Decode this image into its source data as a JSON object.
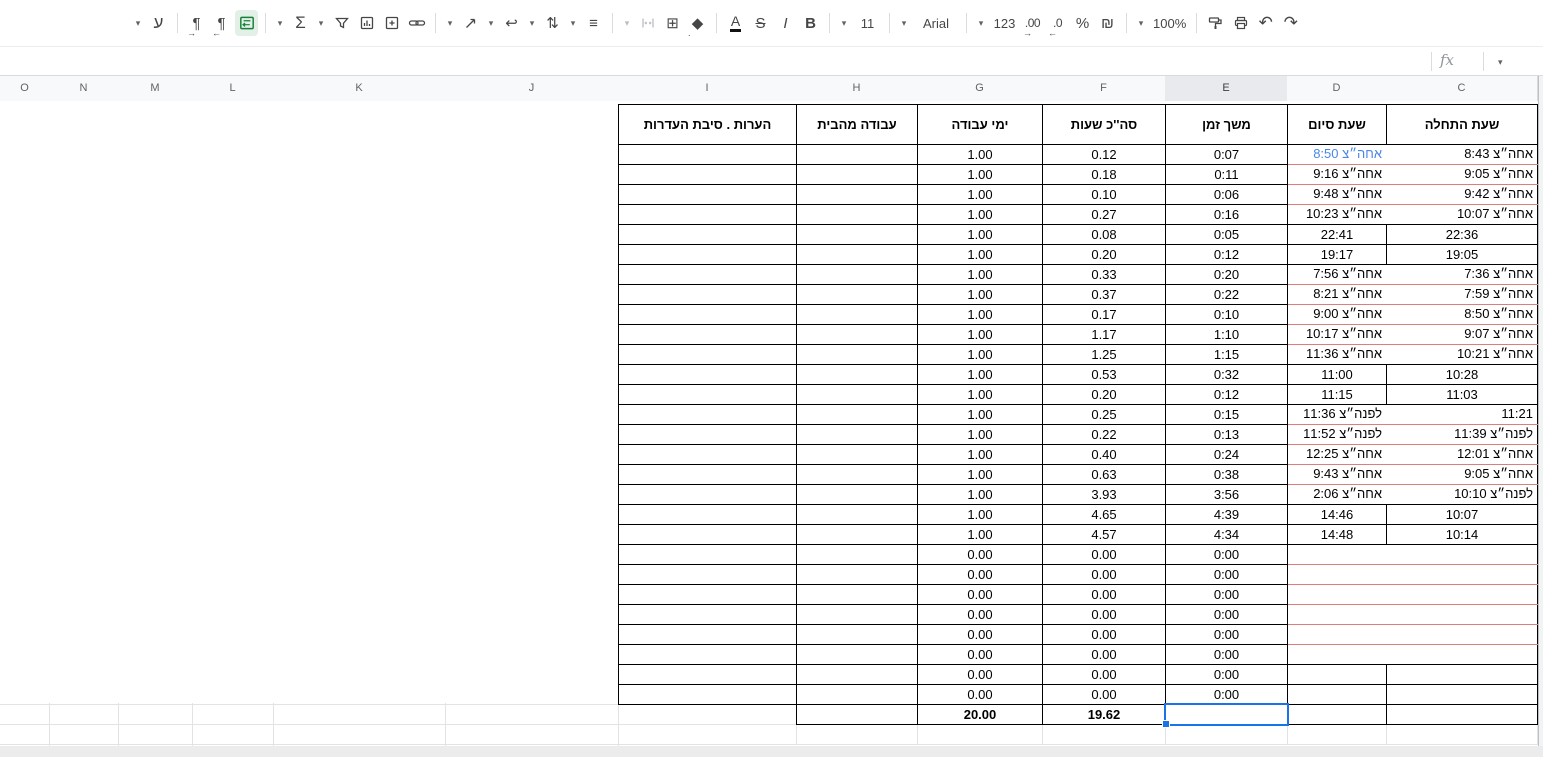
{
  "toolbar": {
    "items": [
      {
        "name": "toolbar-overflow-dropdown",
        "type": "icon",
        "glyph": "▾",
        "small": true
      },
      {
        "name": "input-tools-button",
        "type": "icon",
        "glyph": "ע",
        "cls": "biglyph"
      },
      {
        "type": "sep"
      },
      {
        "name": "text-direction-ltr-button",
        "type": "icon",
        "glyph": "¶",
        "sub": "→"
      },
      {
        "name": "text-direction-rtl-button",
        "type": "icon",
        "glyph": "¶",
        "sub": "←"
      },
      {
        "name": "sheet-direction-rtl-button",
        "type": "svg",
        "svg": "sheetdir",
        "active": true
      },
      {
        "type": "sep"
      },
      {
        "name": "functions-dropdown",
        "type": "icon",
        "glyph": "▾",
        "small": true
      },
      {
        "name": "functions-button",
        "type": "icon",
        "glyph": "Σ",
        "cls": "biglyph"
      },
      {
        "name": "filter-views-dropdown",
        "type": "icon",
        "glyph": "▾",
        "small": true
      },
      {
        "name": "create-filter-button",
        "type": "svg",
        "svg": "funnel"
      },
      {
        "name": "insert-chart-button",
        "type": "svg",
        "svg": "chart"
      },
      {
        "name": "insert-comment-button",
        "type": "svg",
        "svg": "note"
      },
      {
        "name": "insert-link-button",
        "type": "svg",
        "svg": "link"
      },
      {
        "type": "sep"
      },
      {
        "name": "text-rotation-dropdown",
        "type": "icon",
        "glyph": "▾",
        "small": true
      },
      {
        "name": "text-rotation-button",
        "type": "svg",
        "svg": "rotation"
      },
      {
        "name": "text-wrapping-dropdown",
        "type": "icon",
        "glyph": "▾",
        "small": true
      },
      {
        "name": "text-wrapping-button",
        "type": "icon",
        "glyph": "↩"
      },
      {
        "name": "vertical-align-dropdown",
        "type": "icon",
        "glyph": "▾",
        "small": true
      },
      {
        "name": "vertical-align-button",
        "type": "icon",
        "glyph": "⇅"
      },
      {
        "name": "horizontal-align-dropdown",
        "type": "icon",
        "glyph": "▾",
        "small": true
      },
      {
        "name": "horizontal-align-button",
        "type": "icon",
        "glyph": "≡"
      },
      {
        "type": "sep"
      },
      {
        "name": "merge-type-dropdown",
        "type": "icon",
        "glyph": "▾",
        "small": true,
        "disabled": true
      },
      {
        "name": "merge-cells-button",
        "type": "svg",
        "svg": "merge",
        "disabled": true
      },
      {
        "name": "borders-button",
        "type": "icon",
        "glyph": "⊞"
      },
      {
        "name": "fill-color-button",
        "type": "icon",
        "glyph": "◆",
        "sub": "."
      },
      {
        "type": "sep"
      },
      {
        "name": "text-color-button",
        "type": "icon",
        "glyph": "A",
        "cls": "textcolor"
      },
      {
        "name": "strikethrough-button",
        "type": "icon",
        "glyph": "S",
        "cls": "strike"
      },
      {
        "name": "italic-button",
        "type": "icon",
        "glyph": "I",
        "cls": "ital"
      },
      {
        "name": "bold-button",
        "type": "icon",
        "glyph": "B",
        "cls": "boldb"
      },
      {
        "type": "sep"
      },
      {
        "name": "font-size-dropdown",
        "type": "icon",
        "glyph": "▾",
        "small": true
      },
      {
        "name": "font-size-value",
        "type": "text",
        "glyph": "11"
      },
      {
        "type": "sep"
      },
      {
        "name": "font-family-dropdown",
        "type": "icon",
        "glyph": "▾",
        "small": true
      },
      {
        "name": "font-family-value",
        "type": "text",
        "glyph": "Arial",
        "wide": true
      },
      {
        "type": "sep"
      },
      {
        "name": "number-format-dropdown",
        "type": "icon",
        "glyph": "▾",
        "small": true
      },
      {
        "name": "number-format-button",
        "type": "text",
        "glyph": "123"
      },
      {
        "name": "increase-decimals-button",
        "type": "icon",
        "glyph": ".00",
        "sub": "→",
        "cls": "dec"
      },
      {
        "name": "decrease-decimals-button",
        "type": "icon",
        "glyph": ".0",
        "sub": "←",
        "cls": "dec"
      },
      {
        "name": "percent-format-button",
        "type": "icon",
        "glyph": "%"
      },
      {
        "name": "currency-format-button",
        "type": "icon",
        "glyph": "₪"
      },
      {
        "type": "sep"
      },
      {
        "name": "zoom-dropdown",
        "type": "icon",
        "glyph": "▾",
        "small": true
      },
      {
        "name": "zoom-value",
        "type": "text",
        "glyph": "100%"
      },
      {
        "type": "sep"
      },
      {
        "name": "paint-format-button",
        "type": "svg",
        "svg": "roller"
      },
      {
        "name": "print-button",
        "type": "svg",
        "svg": "printer"
      },
      {
        "name": "undo-button",
        "type": "icon",
        "glyph": "↶",
        "cls": "biglyph"
      },
      {
        "name": "redo-button",
        "type": "icon",
        "glyph": "↷",
        "cls": "biglyph"
      }
    ]
  },
  "formula_bar": {
    "fx_label": "fx",
    "dropdown_glyph": "▾"
  },
  "grid": {
    "col_letters": [
      "O",
      "N",
      "M",
      "L",
      "K",
      "J",
      "I",
      "H",
      "G",
      "F",
      "E",
      "D",
      "C"
    ],
    "selected_column": "E",
    "headers": {
      "i": "הערות . סיבת העדרות",
      "h": "עבודה מהבית",
      "g": "ימי עבודה",
      "f": "סה''כ שעות",
      "e": "משך זמן",
      "d": "שעת סיום",
      "c": "שעת התחלה"
    },
    "rows": [
      {
        "c": "אחה״צ 8:43",
        "d": "אחה״צ 8:50",
        "e": "0:07",
        "f": "0.12",
        "g": "1.00",
        "style": "pink",
        "d_blue": true
      },
      {
        "c": "אחה״צ 9:05",
        "d": "אחה״צ 9:16",
        "e": "0:11",
        "f": "0.18",
        "g": "1.00",
        "style": "pink"
      },
      {
        "c": "אחה״צ 9:42",
        "d": "אחה״צ 9:48",
        "e": "0:06",
        "f": "0.10",
        "g": "1.00",
        "style": "pink"
      },
      {
        "c": "אחה״צ 10:07",
        "d": "אחה״צ 10:23",
        "e": "0:16",
        "f": "0.27",
        "g": "1.00",
        "style": "pink"
      },
      {
        "c": "22:36",
        "d": "22:41",
        "e": "0:05",
        "f": "0.08",
        "g": "1.00",
        "style": "black"
      },
      {
        "c": "19:05",
        "d": "19:17",
        "e": "0:12",
        "f": "0.20",
        "g": "1.00",
        "style": "black"
      },
      {
        "c": "אחה״צ 7:36",
        "d": "אחה״צ 7:56",
        "e": "0:20",
        "f": "0.33",
        "g": "1.00",
        "style": "pink"
      },
      {
        "c": "אחה״צ 7:59",
        "d": "אחה״צ 8:21",
        "e": "0:22",
        "f": "0.37",
        "g": "1.00",
        "style": "pink"
      },
      {
        "c": "אחה״צ 8:50",
        "d": "אחה״צ 9:00",
        "e": "0:10",
        "f": "0.17",
        "g": "1.00",
        "style": "pink"
      },
      {
        "c": "אחה״צ 9:07",
        "d": "אחה״צ 10:17",
        "e": "1:10",
        "f": "1.17",
        "g": "1.00",
        "style": "pink"
      },
      {
        "c": "אחה״צ 10:21",
        "d": "אחה״צ 11:36",
        "e": "1:15",
        "f": "1.25",
        "g": "1.00",
        "style": "pink"
      },
      {
        "c": "10:28",
        "d": "11:00",
        "e": "0:32",
        "f": "0.53",
        "g": "1.00",
        "style": "black"
      },
      {
        "c": "11:03",
        "d": "11:15",
        "e": "0:12",
        "f": "0.20",
        "g": "1.00",
        "style": "black"
      },
      {
        "c": "11:21",
        "d": "לפנה״צ 11:36",
        "e": "0:15",
        "f": "0.25",
        "g": "1.00",
        "style": "pink"
      },
      {
        "c": "לפנה״צ 11:39",
        "d": "לפנה״צ 11:52",
        "e": "0:13",
        "f": "0.22",
        "g": "1.00",
        "style": "pink"
      },
      {
        "c": "אחה״צ 12:01",
        "d": "אחה״צ 12:25",
        "e": "0:24",
        "f": "0.40",
        "g": "1.00",
        "style": "pink"
      },
      {
        "c": "אחה״צ 9:05",
        "d": "אחה״צ 9:43",
        "e": "0:38",
        "f": "0.63",
        "g": "1.00",
        "style": "pink"
      },
      {
        "c": "לפנה״צ 10:10",
        "d": "אחה״צ 2:06",
        "e": "3:56",
        "f": "3.93",
        "g": "1.00",
        "style": "pink"
      },
      {
        "c": "10:07",
        "d": "14:46",
        "e": "4:39",
        "f": "4.65",
        "g": "1.00",
        "style": "black"
      },
      {
        "c": "10:14",
        "d": "14:48",
        "e": "4:34",
        "f": "4.57",
        "g": "1.00",
        "style": "black"
      },
      {
        "c": "",
        "d": "",
        "e": "0:00",
        "f": "0.00",
        "g": "0.00",
        "style": "pink"
      },
      {
        "c": "",
        "d": "",
        "e": "0:00",
        "f": "0.00",
        "g": "0.00",
        "style": "pink"
      },
      {
        "c": "",
        "d": "",
        "e": "0:00",
        "f": "0.00",
        "g": "0.00",
        "style": "pink"
      },
      {
        "c": "",
        "d": "",
        "e": "0:00",
        "f": "0.00",
        "g": "0.00",
        "style": "pink"
      },
      {
        "c": "",
        "d": "",
        "e": "0:00",
        "f": "0.00",
        "g": "0.00",
        "style": "pink"
      },
      {
        "c": "",
        "d": "",
        "e": "0:00",
        "f": "0.00",
        "g": "0.00",
        "style": "pink"
      },
      {
        "c": "",
        "d": "",
        "e": "0:00",
        "f": "0.00",
        "g": "0.00",
        "style": "black"
      },
      {
        "c": "",
        "d": "",
        "e": "0:00",
        "f": "0.00",
        "g": "0.00",
        "style": "black"
      }
    ],
    "totals": {
      "f": "19.62",
      "g": "20.00"
    }
  },
  "colors": {
    "selection_blue": "#1a73e8",
    "blue_text": "#4a86e8",
    "pink_border": "#d98078",
    "active_green": "#188038"
  }
}
